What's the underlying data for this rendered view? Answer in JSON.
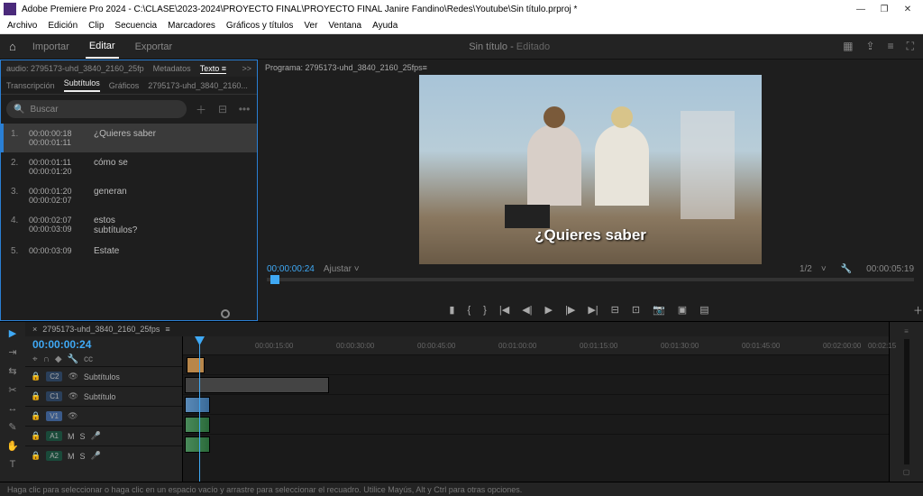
{
  "titlebar": {
    "text": "Adobe Premiere Pro 2024 - C:\\CLASE\\2023-2024\\PROYECTO FINAL\\PROYECTO FINAL Janire Fandino\\Redes\\Youtube\\Sin título.prproj *"
  },
  "menu": [
    "Archivo",
    "Edición",
    "Clip",
    "Secuencia",
    "Marcadores",
    "Gráficos y títulos",
    "Ver",
    "Ventana",
    "Ayuda"
  ],
  "topbar": {
    "tabs": [
      "Importar",
      "Editar",
      "Exportar"
    ],
    "activeTab": "Editar",
    "center_title": "Sin título",
    "center_status": "Editado"
  },
  "leftpanel": {
    "sourceTabs": {
      "audio": "audio: 2795173-uhd_3840_2160_25fp",
      "meta": "Metadatos",
      "texto": "Texto",
      "more": ">>"
    },
    "subTabs": [
      "Transcripción",
      "Subtítulos",
      "Gráficos",
      "2795173-uhd_3840_2160..."
    ],
    "activeSubTab": "Subtítulos",
    "searchPlaceholder": "Buscar",
    "items": [
      {
        "n": "1.",
        "t1": "00:00:00:18",
        "t2": "00:00:01:11",
        "txt": "¿Quieres saber",
        "selected": true
      },
      {
        "n": "2.",
        "t1": "00:00:01:11",
        "t2": "00:00:01:20",
        "txt": "cómo se"
      },
      {
        "n": "3.",
        "t1": "00:00:01:20",
        "t2": "00:00:02:07",
        "txt": "generan"
      },
      {
        "n": "4.",
        "t1": "00:00:02:07",
        "t2": "00:00:03:09",
        "txt1": "estos",
        "txt2": "subtítulos?"
      },
      {
        "n": "5.",
        "t1": "00:00:03:09",
        "t2": "",
        "txt": "Estate"
      }
    ]
  },
  "program": {
    "header": "Programa: 2795173-uhd_3840_2160_25fps",
    "caption": "¿Quieres saber",
    "timecode": "00:00:00:24",
    "fit": "Ajustar",
    "zoom": "1/2",
    "duration": "00:00:05:19"
  },
  "timeline": {
    "seqname": "2795173-uhd_3840_2160_25fps",
    "timecode": "00:00:00:24",
    "ruler": [
      "00:00:15:00",
      "00:00:30:00",
      "00:00:45:00",
      "00:01:00:00",
      "00:01:15:00",
      "00:01:30:00",
      "00:01:45:00",
      "00:02:00:00",
      "00:02:15"
    ],
    "tracks": {
      "c2": "C2",
      "c1": "C1",
      "v1": "V1",
      "a1": "A1",
      "a2": "A2",
      "subtitulo": "Subtítulo",
      "subtitulos": "Subtítulos"
    }
  },
  "statusbar": "Haga clic para seleccionar o haga clic en un espacio vacío y arrastre para seleccionar el recuadro. Utilice Mayús, Alt y Ctrl para otras opciones."
}
